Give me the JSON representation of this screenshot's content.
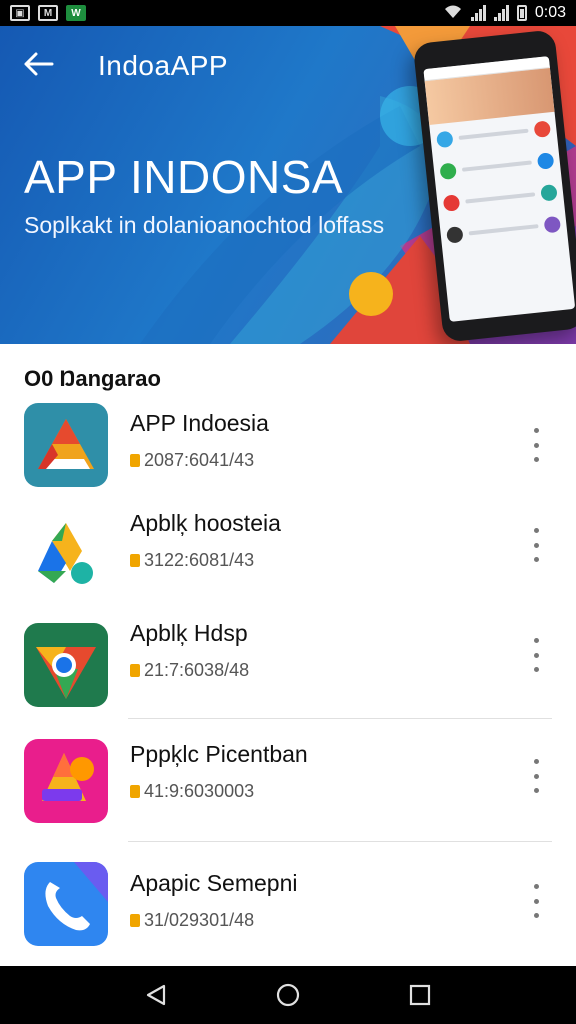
{
  "status_bar": {
    "time": "0:03",
    "left_icons": [
      "image-icon",
      "mail-icon",
      "app-icon"
    ],
    "right_icons": [
      "wifi-icon",
      "signal-icon",
      "signal-icon",
      "battery-icon"
    ]
  },
  "header": {
    "app_name": "IndoaAPP",
    "back_icon": "back-arrow-icon"
  },
  "hero": {
    "title": "APP INDONSA",
    "subtitle": "Soplkakt in dolanioanochtod loffass"
  },
  "section": {
    "title": "O0 Ŋangarao"
  },
  "apps": [
    {
      "name": "APP Indoesia",
      "meta": "2087:6041/43",
      "icon": "triangle-logo-icon"
    },
    {
      "name": "Apblķ hoosteia",
      "meta": "3122:6081/43",
      "icon": "drive-logo-icon"
    },
    {
      "name": "Apblķ Hdsp",
      "meta": "21:7:6038/48",
      "icon": "chrome-logo-icon"
    },
    {
      "name": "Pppķlc Picentban",
      "meta": "41:9:6030003",
      "icon": "colorful-a-logo-icon"
    },
    {
      "name": "Apapic Semepni",
      "meta": "31/029301/48",
      "icon": "phone-logo-icon"
    }
  ],
  "nav": [
    "back-nav-icon",
    "home-nav-icon",
    "recents-nav-icon"
  ]
}
